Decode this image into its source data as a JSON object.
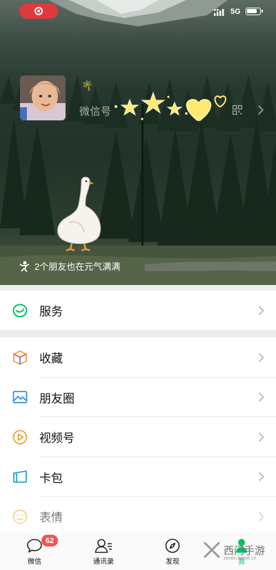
{
  "status_bar": {
    "network": "5G"
  },
  "profile": {
    "wechat_id_label": "微信号",
    "friends_status": "2个朋友也在元气满满"
  },
  "menu": {
    "service": "服务",
    "items": [
      {
        "label": "收藏",
        "icon": "favorites-icon"
      },
      {
        "label": "朋友圈",
        "icon": "moments-icon"
      },
      {
        "label": "视频号",
        "icon": "channels-icon"
      },
      {
        "label": "卡包",
        "icon": "card-wallet-icon"
      },
      {
        "label": "表情",
        "icon": "sticker-emoji-icon"
      }
    ]
  },
  "tab_bar": {
    "chats": {
      "label": "微信",
      "badge": "62"
    },
    "contacts": {
      "label": "通讯录"
    },
    "discover": {
      "label": "发现"
    },
    "me": {
      "label": "我"
    }
  },
  "watermark": {
    "text": "西门手游",
    "sub": "ximen.home.cn"
  },
  "colors": {
    "wechat_green": "#07c160",
    "badge_red": "#f25350",
    "record_red": "#e0393e"
  }
}
